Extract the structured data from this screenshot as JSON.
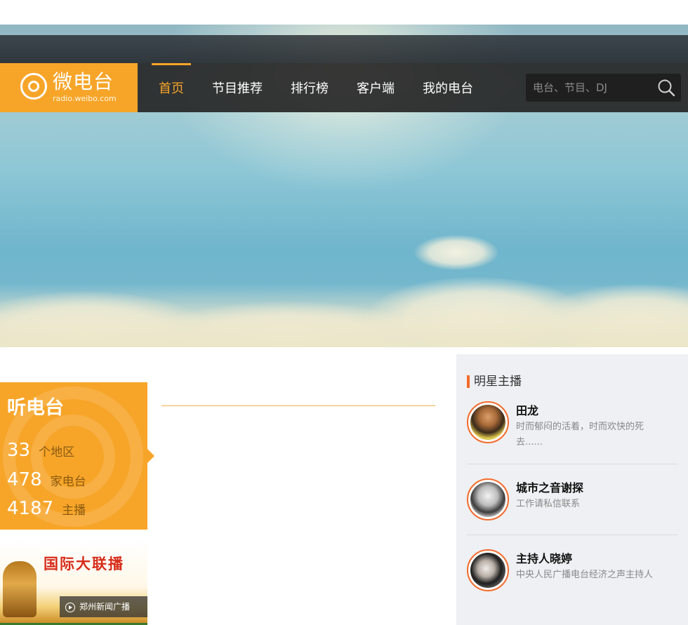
{
  "brand": {
    "name": "微电台",
    "url": "radio.weibo.com"
  },
  "nav": {
    "items": [
      {
        "label": "首页",
        "active": true
      },
      {
        "label": "节目推荐",
        "active": false
      },
      {
        "label": "排行榜",
        "active": false
      },
      {
        "label": "客户端",
        "active": false
      },
      {
        "label": "我的电台",
        "active": false
      }
    ]
  },
  "search": {
    "placeholder": "电台、节目、DJ",
    "value": "",
    "icon": "search-icon"
  },
  "listen": {
    "title": "听电台",
    "stats": [
      {
        "number": "33",
        "unit": "个地区"
      },
      {
        "number": "478",
        "unit": "家电台"
      },
      {
        "number": "4187",
        "unit": "主播"
      }
    ]
  },
  "promo": {
    "banner_title": "国际大联播",
    "caption": "郑州新闻广播",
    "icon": "play-icon"
  },
  "stars": {
    "title": "明星主播",
    "anchors": [
      {
        "name": "田龙",
        "desc": "时而郁闷的活着，时而欢快的死去......"
      },
      {
        "name": "城市之音谢探",
        "desc": "工作请私信联系"
      },
      {
        "name": "主持人晓婷",
        "desc": "中央人民广播电台经济之声主持人"
      }
    ]
  },
  "colors": {
    "accent": "#f7a529",
    "star_border": "#f46b2a",
    "nav_bg": "#262626"
  }
}
